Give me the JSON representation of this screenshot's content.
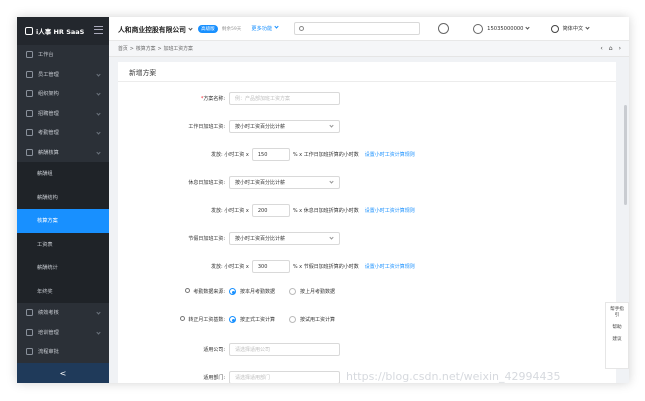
{
  "app": {
    "logo_text": "i人事 HR SaaS",
    "collapse_glyph": "<"
  },
  "sidebar": {
    "items_top": [
      {
        "label": "工作台"
      },
      {
        "label": "员工管理"
      },
      {
        "label": "组织架构"
      },
      {
        "label": "招聘管理"
      },
      {
        "label": "考勤管理"
      },
      {
        "label": "薪酬核算"
      }
    ],
    "sub_items": [
      {
        "label": "薪酬组"
      },
      {
        "label": "薪酬结构"
      },
      {
        "label": "核算方案"
      },
      {
        "label": "工资表"
      },
      {
        "label": "薪酬统计"
      },
      {
        "label": "年终奖"
      }
    ],
    "items_bottom": [
      {
        "label": "绩效考核"
      },
      {
        "label": "培训管理"
      },
      {
        "label": "流程审批"
      }
    ]
  },
  "header": {
    "company": "人和商业控股有限公司",
    "badge": "高级版",
    "trial": "剩余59天",
    "more": "更多功能",
    "phone": "15035000000",
    "lang": "简体中文"
  },
  "breadcrumb": {
    "items": [
      "首页",
      "核算方案",
      "加班工资方案"
    ],
    "sep": ">"
  },
  "form": {
    "title": "新增方案",
    "scheme_name": {
      "label": "方案名称:",
      "required_mark": "*",
      "placeholder": "例：产品部加班工资方案"
    },
    "workday": {
      "label": "工作日加班工资:",
      "select": "按小时工资百分比计薪",
      "rate_prefix": "发放: 小时工资 x",
      "rate": "150",
      "rate_suffix": "% x 工作日加班折算的小时数",
      "link": "设置小时工资计算规则"
    },
    "restday": {
      "label": "休息日加班工资:",
      "select": "按小时工资百分比计薪",
      "rate_prefix": "发放: 小时工资 x",
      "rate": "200",
      "rate_suffix": "% x 休息日加班折算的小时数",
      "link": "设置小时工资计算规则"
    },
    "holiday": {
      "label": "节假日加班工资:",
      "select": "按小时工资百分比计薪",
      "rate_prefix": "发放: 小时工资 x",
      "rate": "300",
      "rate_suffix": "% x 节假日加班折算的小时数",
      "link": "设置小时工资计算规则"
    },
    "attendance_source": {
      "label": "考勤数据来源:",
      "options": [
        "按本月考勤数据",
        "按上月考勤数据"
      ],
      "selected": 0
    },
    "regular_basis": {
      "label": "转正月工资基数:",
      "options": [
        "按正式工资计算",
        "按试用工资计算"
      ],
      "selected": 0
    },
    "company": {
      "label": "适用公司:",
      "placeholder": "请选择适用公司"
    },
    "department": {
      "label": "适用部门:",
      "placeholder": "请选择适用部门"
    }
  },
  "help_panel": {
    "items": [
      "帮手指引",
      "帮助",
      "建议"
    ]
  },
  "watermark": "https://blog.csdn.net/weixin_42994435"
}
